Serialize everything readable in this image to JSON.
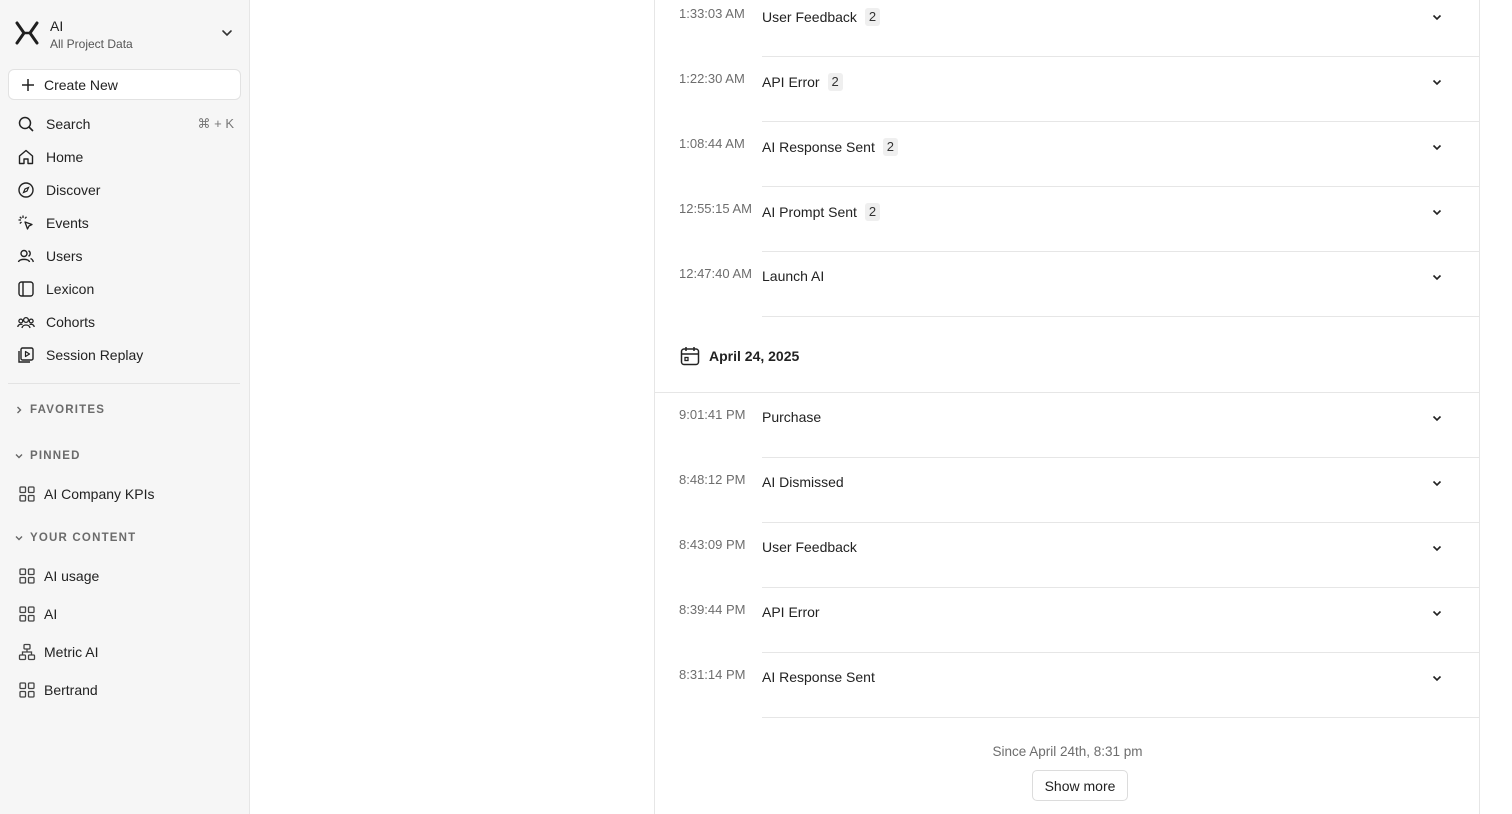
{
  "project": {
    "name": "AI",
    "subtitle": "All Project Data"
  },
  "sidebar": {
    "create_label": "Create New",
    "nav": [
      {
        "label": "Search",
        "icon": "search-icon",
        "shortcut": "⌘ + K"
      },
      {
        "label": "Home",
        "icon": "home-icon"
      },
      {
        "label": "Discover",
        "icon": "compass-icon"
      },
      {
        "label": "Events",
        "icon": "click-icon"
      },
      {
        "label": "Users",
        "icon": "users-icon"
      },
      {
        "label": "Lexicon",
        "icon": "book-icon"
      },
      {
        "label": "Cohorts",
        "icon": "cohorts-icon"
      },
      {
        "label": "Session Replay",
        "icon": "replay-icon"
      }
    ],
    "favorites_label": "FAVORITES",
    "pinned_label": "PINNED",
    "pinned": [
      {
        "label": "AI Company KPIs",
        "icon": "board-icon"
      }
    ],
    "your_content_label": "YOUR CONTENT",
    "your_content": [
      {
        "label": "AI usage",
        "icon": "board-icon"
      },
      {
        "label": "AI",
        "icon": "board-icon"
      },
      {
        "label": "Metric AI",
        "icon": "metric-tree-icon"
      },
      {
        "label": "Bertrand",
        "icon": "board-icon"
      }
    ]
  },
  "feed": {
    "rows_top": [
      {
        "time": "1:33:03 AM",
        "event": "User Feedback",
        "count": "2"
      },
      {
        "time": "1:22:30 AM",
        "event": "API Error",
        "count": "2"
      },
      {
        "time": "1:08:44 AM",
        "event": "AI Response Sent",
        "count": "2"
      },
      {
        "time": "12:55:15 AM",
        "event": "AI Prompt Sent",
        "count": "2"
      },
      {
        "time": "12:47:40 AM",
        "event": "Launch AI",
        "count": ""
      }
    ],
    "date_header": "April 24, 2025",
    "rows_bottom": [
      {
        "time": "9:01:41 PM",
        "event": "Purchase",
        "count": ""
      },
      {
        "time": "8:48:12 PM",
        "event": "AI Dismissed",
        "count": ""
      },
      {
        "time": "8:43:09 PM",
        "event": "User Feedback",
        "count": ""
      },
      {
        "time": "8:39:44 PM",
        "event": "API Error",
        "count": ""
      },
      {
        "time": "8:31:14 PM",
        "event": "AI Response Sent",
        "count": ""
      }
    ],
    "since": "Since April 24th, 8:31 pm",
    "show_more": "Show more"
  }
}
